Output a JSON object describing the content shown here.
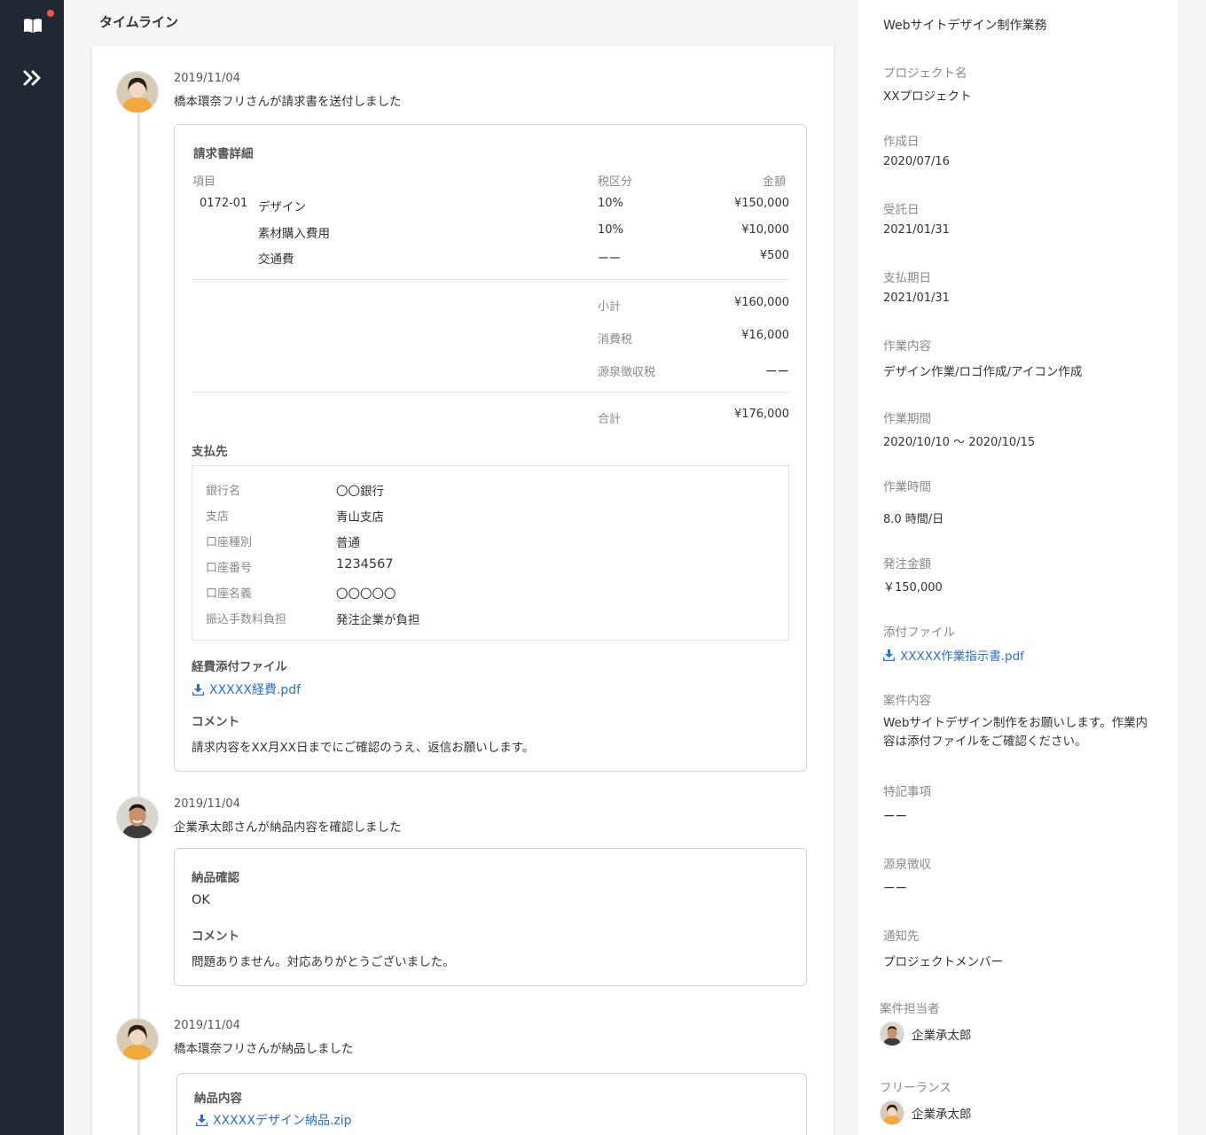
{
  "colors": {
    "rail": "#1f2833",
    "notification": "#f0524f",
    "link": "#2a72c9"
  },
  "rail": {
    "icons": [
      "book-icon",
      "expand-double-chevron-icon"
    ]
  },
  "timeline": {
    "title": "タイムライン",
    "events": [
      {
        "date": "2019/11/04",
        "text": "橋本環奈フリさんが請求書を送付しました",
        "invoice": {
          "title": "請求書詳細",
          "headers": {
            "item": "項目",
            "tax": "税区分",
            "amount": "金額"
          },
          "rows": [
            {
              "code": "0172-01",
              "name": "デザイン",
              "tax": "10%",
              "amount": "¥150,000"
            },
            {
              "code": "",
              "name": "素材購入費用",
              "tax": "10%",
              "amount": "¥10,000"
            },
            {
              "code": "",
              "name": "交通費",
              "tax": "ーー",
              "amount": "¥500"
            }
          ],
          "subtotal": {
            "label": "小計",
            "value": "¥160,000"
          },
          "consumption_tax": {
            "label": "消費税",
            "value": "¥16,000"
          },
          "withholding": {
            "label": "源泉徴収税",
            "value": "ーー"
          },
          "total": {
            "label": "合計",
            "value": "¥176,000"
          },
          "payee": {
            "title": "支払先",
            "rows": [
              {
                "label": "銀行名",
                "value": "〇〇銀行"
              },
              {
                "label": "支店",
                "value": "青山支店"
              },
              {
                "label": "口座種別",
                "value": "普通"
              },
              {
                "label": "口座番号",
                "value": "1234567"
              },
              {
                "label": "口座名義",
                "value": "〇〇〇〇〇"
              },
              {
                "label": "振込手数料負担",
                "value": "発注企業が負担"
              }
            ]
          },
          "attachment": {
            "title": "経費添付ファイル",
            "file": "XXXXX経費.pdf"
          },
          "comment": {
            "title": "コメント",
            "text": "請求内容をXX月XX日までにご確認のうえ、返信お願いします。"
          }
        }
      },
      {
        "date": "2019/11/04",
        "text": "企業承太郎さんが納品内容を確認しました",
        "confirm": {
          "title": "納品確認",
          "value": "OK",
          "comment_title": "コメント",
          "comment": "問題ありません。対応ありがとうございました。"
        }
      },
      {
        "date": "2019/11/04",
        "text": "橋本環奈フリさんが納品しました",
        "delivery": {
          "title": "納品内容",
          "file": "XXXXXデザイン納品.zip"
        }
      }
    ]
  },
  "panel": {
    "job_title": "Webサイトデザイン制作業務",
    "fields": [
      {
        "label": "プロジェクト名",
        "value": "XXプロジェクト"
      },
      {
        "label": "作成日",
        "value": "2020/07/16"
      },
      {
        "label": "受託日",
        "value": "2021/01/31"
      },
      {
        "label": "支払期日",
        "value": "2021/01/31"
      },
      {
        "label": "作業内容",
        "value": "デザイン作業/ロゴ作成/アイコン作成"
      },
      {
        "label": "作業期間",
        "value": "2020/10/10 〜 2020/10/15"
      },
      {
        "label": "作業時間",
        "value": "8.0 時間/日"
      },
      {
        "label": "発注金額",
        "value": "￥150,000"
      },
      {
        "label": "添付ファイル",
        "value": "XXXXX作業指示書.pdf"
      },
      {
        "label": "案件内容",
        "value": "Webサイトデザイン制作をお願いします。作業内容は添付ファイルをご確認ください。"
      },
      {
        "label": "特記事項",
        "value": "ーー"
      },
      {
        "label": "源泉徴収",
        "value": "ーー"
      },
      {
        "label": "通知先",
        "value": "プロジェクトメンバー"
      }
    ],
    "manager": {
      "label": "案件担当者",
      "name": "企業承太郎"
    },
    "freelancer": {
      "label": "フリーランス",
      "name": "企業承太郎"
    }
  }
}
